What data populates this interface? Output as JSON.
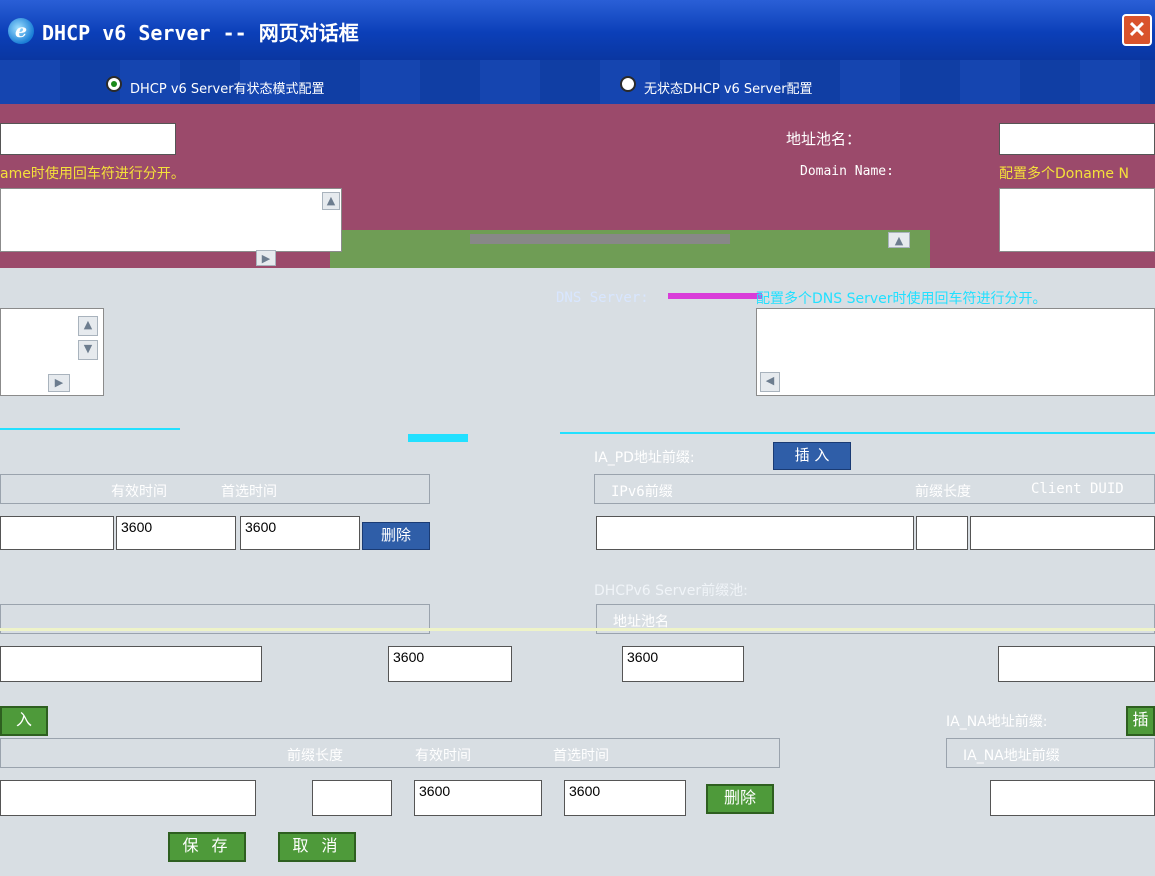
{
  "window": {
    "title": "DHCP v6 Server -- 网页对话框",
    "close_label": "✕"
  },
  "modes": [
    {
      "label": "DHCP v6 Server有状态模式配置",
      "selected": true
    },
    {
      "label": "无状态DHCP v6 Server配置",
      "selected": false
    }
  ],
  "pool": {
    "name_label": "地址池名：",
    "name_value": "",
    "domain_hint_left": "ame时使用回车符进行分开。",
    "domain_label": "Domain Name:",
    "domain_hint_right": "配置多个Doname N"
  },
  "dns": {
    "label": "DNS Server:",
    "hint": "配置多个DNS Server时使用回车符进行分开。"
  },
  "ia_pd": {
    "label": "IA_PD地址前缀:",
    "insert_button": "插 入",
    "columns": [
      "IPv6前缀",
      "前缀长度",
      "Client DUID"
    ]
  },
  "left_table_1": {
    "columns": [
      "有效时间",
      "首选时间"
    ],
    "row": {
      "valid": "3600",
      "preferred": "3600"
    },
    "delete_button": "删除"
  },
  "prefix_pool": {
    "label": "DHCPv6 Server前缀池:",
    "pool_name_col": "地址池名",
    "row": {
      "valid": "3600",
      "preferred": "3600"
    }
  },
  "ia_na": {
    "label": "IA_NA地址前缀:",
    "insert_button": "插",
    "column": "IA_NA地址前缀",
    "left_insert_button": "入"
  },
  "left_table_2": {
    "columns": [
      "前缀长度",
      "有效时间",
      "首选时间"
    ],
    "row": {
      "valid": "3600",
      "preferred": "3600"
    },
    "delete_button": "删除"
  },
  "actions": {
    "save": "保 存",
    "cancel": "取 消"
  },
  "colors": {
    "titlebar": "#0b3fb8",
    "maroon": "#9b4a6b",
    "panel": "#d8dee3",
    "yellow_hint": "#f5e13a",
    "cyan_hint": "#22e0ff"
  }
}
